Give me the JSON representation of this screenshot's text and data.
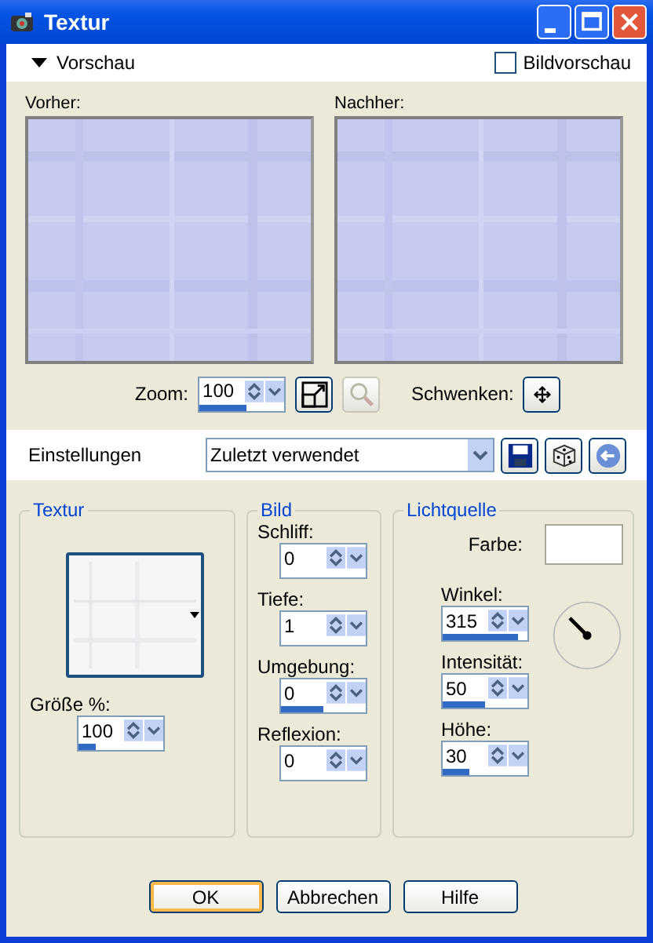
{
  "window": {
    "title": "Textur"
  },
  "preview": {
    "label": "Vorschau",
    "expanded": true,
    "image_preview": {
      "label": "Bildvorschau",
      "checked": false
    },
    "before_label": "Vorher:",
    "after_label": "Nachher:",
    "zoom": {
      "label": "Zoom:",
      "value": "100",
      "level": 0.55
    },
    "tools": [
      {
        "kind": "fit",
        "disabled": false
      },
      {
        "kind": "magnifier",
        "disabled": true
      }
    ],
    "pan_label": "Schwenken:"
  },
  "settings": {
    "label": "Einstellungen",
    "preset": "Zuletzt verwendet"
  },
  "texture": {
    "title": "Textur",
    "size": {
      "label": "Größe %:",
      "value": "100",
      "level": 0.2
    }
  },
  "image": {
    "title": "Bild",
    "fields": [
      {
        "label": "Schliff:",
        "value": "0",
        "level": 0
      },
      {
        "label": "Tiefe:",
        "value": "1",
        "level": 0
      },
      {
        "label": "Umgebung:",
        "value": "0",
        "level": 0.5
      },
      {
        "label": "Reflexion:",
        "value": "0",
        "level": 0
      }
    ]
  },
  "light": {
    "title": "Lichtquelle",
    "color_label": "Farbe:",
    "color": "#ffffff",
    "fields": [
      {
        "label": "Winkel:",
        "value": "315",
        "level": 0.88
      },
      {
        "label": "Intensität:",
        "value": "50",
        "level": 0.5
      },
      {
        "label": "Höhe:",
        "value": "30",
        "level": 0.32
      }
    ]
  },
  "buttons": [
    {
      "label": "OK",
      "default": true
    },
    {
      "label": "Abbrechen",
      "default": false
    },
    {
      "label": "Hilfe",
      "default": false
    }
  ]
}
